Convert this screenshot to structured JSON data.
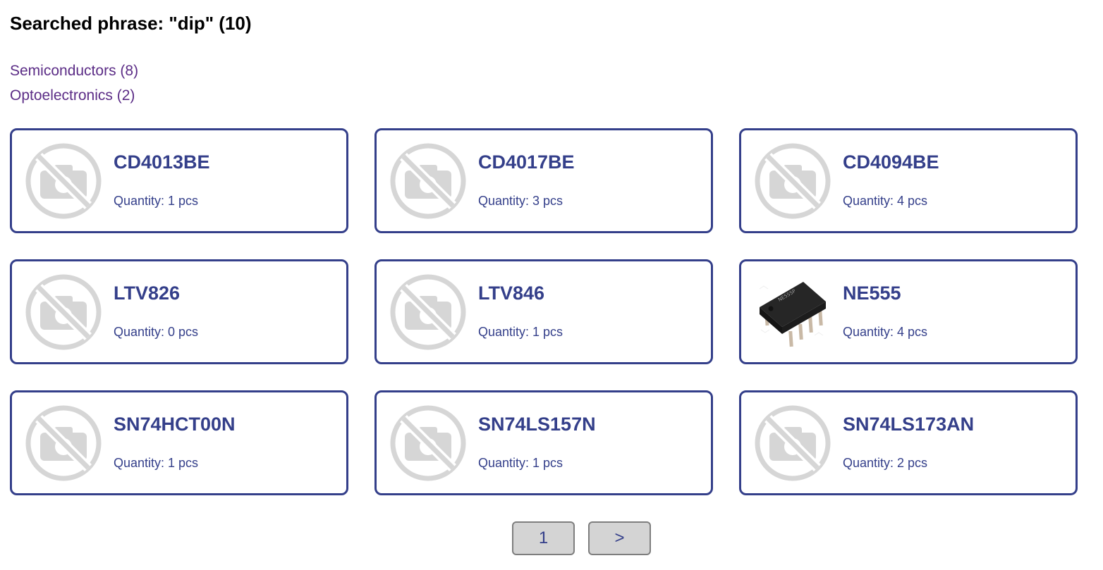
{
  "search": {
    "title": "Searched phrase: \"dip\" (10)"
  },
  "categories": [
    {
      "label": "Semiconductors (8)"
    },
    {
      "label": "Optoelectronics (2)"
    }
  ],
  "products": [
    {
      "name": "CD4013BE",
      "quantity": "Quantity: 1 pcs",
      "image": "no-image-icon"
    },
    {
      "name": "CD4017BE",
      "quantity": "Quantity: 3 pcs",
      "image": "no-image-icon"
    },
    {
      "name": "CD4094BE",
      "quantity": "Quantity: 4 pcs",
      "image": "no-image-icon"
    },
    {
      "name": "LTV826",
      "quantity": "Quantity: 0 pcs",
      "image": "no-image-icon"
    },
    {
      "name": "LTV846",
      "quantity": "Quantity: 1 pcs",
      "image": "no-image-icon"
    },
    {
      "name": "NE555",
      "quantity": "Quantity: 4 pcs",
      "image": "dip-chip-photo"
    },
    {
      "name": "SN74HCT00N",
      "quantity": "Quantity: 1 pcs",
      "image": "no-image-icon"
    },
    {
      "name": "SN74LS157N",
      "quantity": "Quantity: 1 pcs",
      "image": "no-image-icon"
    },
    {
      "name": "SN74LS173AN",
      "quantity": "Quantity: 2 pcs",
      "image": "no-image-icon"
    }
  ],
  "pagination": {
    "current_page": "1",
    "next_label": ">"
  },
  "colors": {
    "accent": "#343f8a",
    "link": "#5b2c86",
    "placeholder": "#d6d6d6",
    "button_bg": "#d4d4d4"
  }
}
